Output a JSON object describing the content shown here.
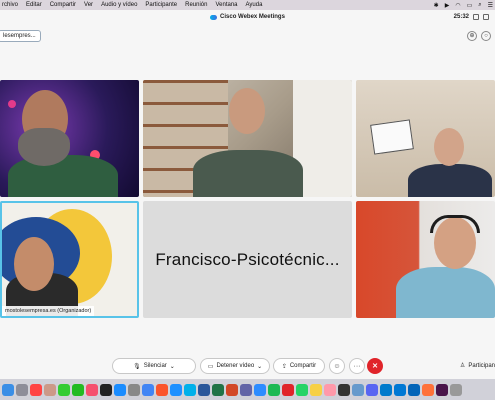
{
  "menubar": {
    "items": [
      "rchivo",
      "Editar",
      "Compartir",
      "Ver",
      "Audio y vídeo",
      "Participante",
      "Reunión",
      "Ventana",
      "Ayuda"
    ]
  },
  "window": {
    "title": "Cisco Webex Meetings",
    "clock": "25:32"
  },
  "name_chip": "lesempres...",
  "tiles": {
    "presenter_name": "Francisco-Psicotécnic...",
    "organizer_label": "mostolesempresa.es  (Organizador)"
  },
  "controls": {
    "mute_label": "Silenciar",
    "stop_video_label": "Detener vídeo",
    "share_label": "Compartir",
    "more_label": "···",
    "participants_label": "Participan"
  },
  "colors": {
    "end_call": "#e0242a",
    "active_speaker_border": "#58c3e8"
  },
  "dock_icons": [
    "finder-icon",
    "launchpad-icon",
    "calendar-icon",
    "contacts-icon",
    "messages-icon",
    "facetime-icon",
    "music-icon",
    "tv-icon",
    "appstore-icon",
    "settings-icon",
    "chrome-icon",
    "brave-icon",
    "safari-icon",
    "webex-icon",
    "word-icon",
    "excel-icon",
    "powerpoint-icon",
    "teams-icon",
    "zoom-icon",
    "spotify-icon",
    "acrobat-icon",
    "whatsapp-icon",
    "notes-icon",
    "photos-icon",
    "terminal-icon",
    "preview-icon",
    "discord-icon",
    "vscode-icon",
    "outlook-icon",
    "onedrive-icon",
    "firefox-icon",
    "slack-icon",
    "trash-icon"
  ]
}
